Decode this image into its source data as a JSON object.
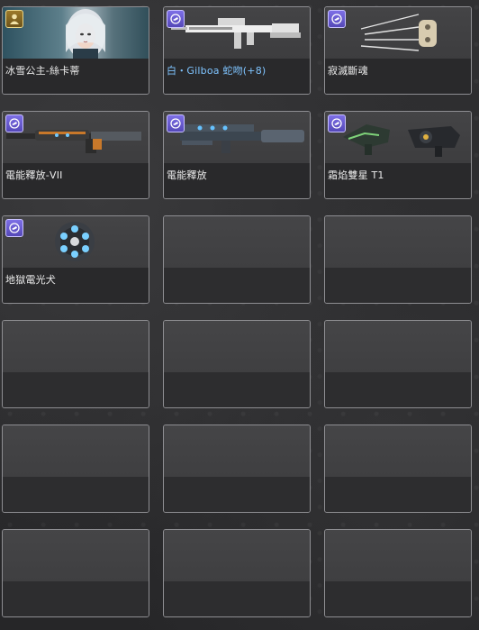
{
  "inventory": {
    "slots": [
      {
        "name": "冰雪公主-絲卡蒂",
        "badge": "character",
        "badge_icon": "person-icon",
        "art": "character-portrait"
      },
      {
        "name": "白・Gilboa 蛇吻(+8)",
        "badge": "weapon",
        "badge_icon": "pistol-icon",
        "art": "assault-rifle",
        "name_color": "#7fc4ff"
      },
      {
        "name": "寂滅斷魂",
        "badge": "weapon",
        "badge_icon": "pistol-icon",
        "art": "claw-knuckles"
      },
      {
        "name": "電能釋放-VII",
        "badge": "weapon",
        "badge_icon": "pistol-icon",
        "art": "energy-rifle-long"
      },
      {
        "name": "電能釋放",
        "badge": "weapon",
        "badge_icon": "pistol-icon",
        "art": "energy-rifle"
      },
      {
        "name": "霜焰雙星 T1",
        "badge": "weapon",
        "badge_icon": "pistol-icon",
        "art": "dual-pistols"
      },
      {
        "name": "地獄電光犬",
        "badge": "weapon",
        "badge_icon": "pistol-icon",
        "art": "sphere-grenade"
      }
    ],
    "empty_slot_count": 11
  }
}
